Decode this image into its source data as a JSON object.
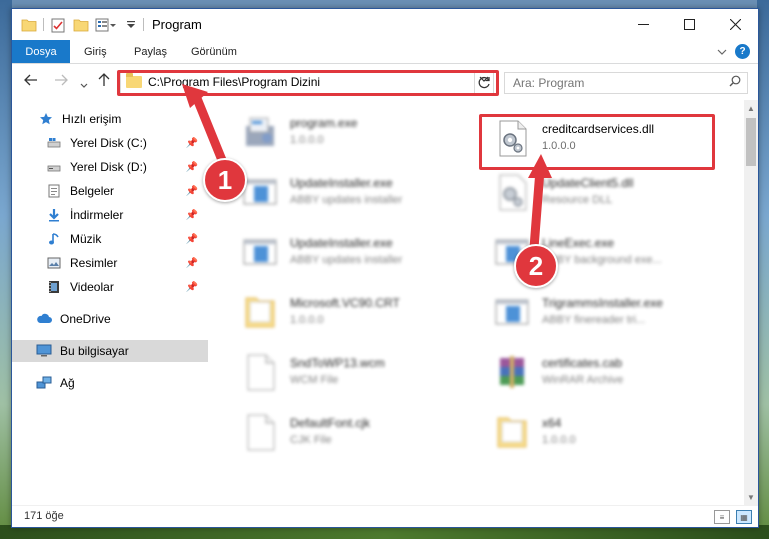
{
  "titlebar": {
    "title": "Program"
  },
  "ribbon": {
    "tabs": [
      "Dosya",
      "Giriş",
      "Paylaş",
      "Görünüm"
    ]
  },
  "navbar": {
    "address_path": "C:\\Program Files\\Program Dizini",
    "search_placeholder": "Ara: Program"
  },
  "sidebar": {
    "items": [
      {
        "label": "Hızlı erişim",
        "icon": "star-icon"
      },
      {
        "label": "Yerel Disk (C:)",
        "icon": "drive-icon",
        "pinned": true
      },
      {
        "label": "Yerel Disk (D:)",
        "icon": "drive-icon",
        "pinned": true
      },
      {
        "label": "Belgeler",
        "icon": "documents-icon",
        "pinned": true
      },
      {
        "label": "İndirmeler",
        "icon": "download-icon",
        "pinned": true
      },
      {
        "label": "Müzik",
        "icon": "music-icon",
        "pinned": true
      },
      {
        "label": "Resimler",
        "icon": "pictures-icon",
        "pinned": true
      },
      {
        "label": "Videolar",
        "icon": "video-icon",
        "pinned": true
      },
      {
        "label": "OneDrive",
        "icon": "cloud-icon"
      },
      {
        "label": "Bu bilgisayar",
        "icon": "computer-icon",
        "selected": true
      },
      {
        "label": "Ağ",
        "icon": "network-icon"
      }
    ]
  },
  "files": [
    {
      "name": "program.exe",
      "sub": "1.0.0.0",
      "icon": "exe-setup-icon",
      "blurred": true
    },
    {
      "name": "creditcardservices.dll",
      "sub": "1.0.0.0",
      "icon": "dll-gear-icon",
      "blurred": false
    },
    {
      "name": "UpdateInstaller.exe",
      "sub": "ABBY updates installer",
      "icon": "app-window-icon",
      "blurred": true
    },
    {
      "name": "UpdateClient5.dll",
      "sub": "Resource DLL",
      "icon": "dll-gear-icon",
      "blurred": true
    },
    {
      "name": "UpdateInstaller.exe",
      "sub": "ABBY updates installer",
      "icon": "app-window-icon",
      "blurred": true
    },
    {
      "name": "LineExec.exe",
      "sub": "ABBY background exe...",
      "icon": "app-window-icon",
      "blurred": true
    },
    {
      "name": "Microsoft.VC90.CRT",
      "sub": "1.0.0.0",
      "icon": "folder-icon",
      "blurred": true
    },
    {
      "name": "TrigrammsInstaller.exe",
      "sub": "ABBY finereader tri...",
      "icon": "app-window-icon",
      "blurred": true
    },
    {
      "name": "SndToWP13.wcm",
      "sub": "WCM File",
      "icon": "blank-file-icon",
      "blurred": true
    },
    {
      "name": "certificates.cab",
      "sub": "WinRAR Archive",
      "icon": "winrar-icon",
      "blurred": true
    },
    {
      "name": "DefaultFont.cjk",
      "sub": "CJK File",
      "icon": "blank-file-icon",
      "blurred": true
    },
    {
      "name": "x64",
      "sub": "1.0.0.0",
      "icon": "folder-icon",
      "blurred": true
    }
  ],
  "statusbar": {
    "count": "171 öğe"
  },
  "callouts": [
    "1",
    "2"
  ],
  "colors": {
    "accent": "#1979ca",
    "highlight": "#e0373d",
    "selected_bg": "#d9d9d9"
  }
}
